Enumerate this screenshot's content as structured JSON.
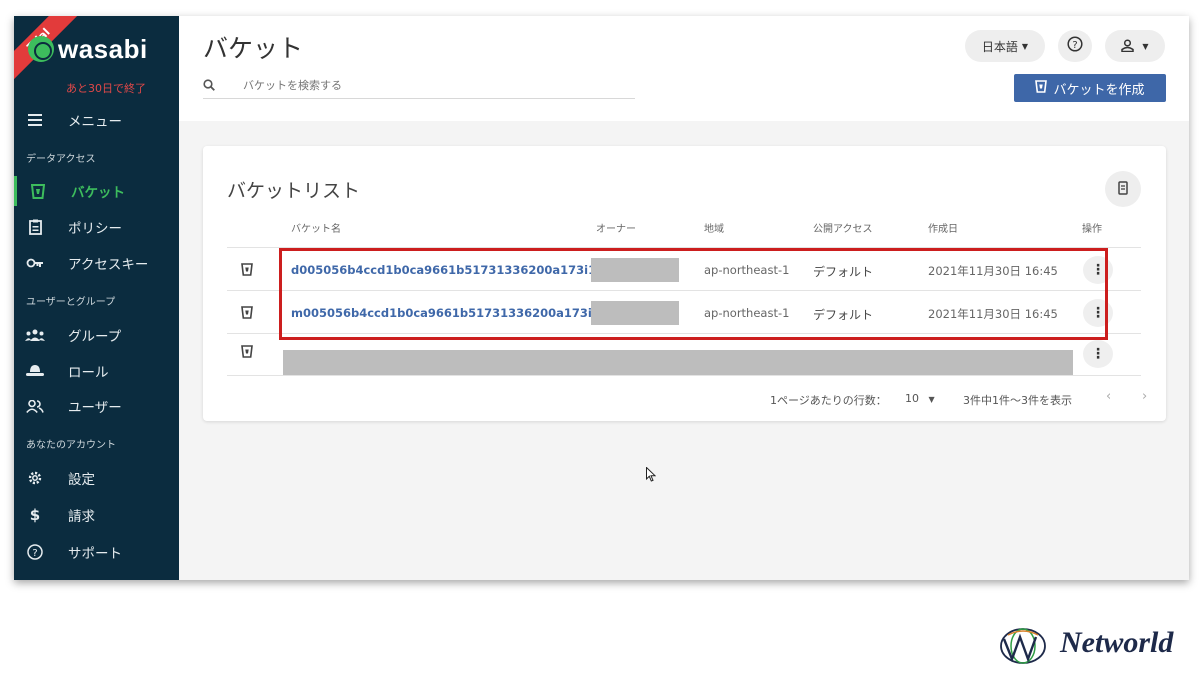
{
  "sidebar": {
    "trial_badge": "Trial",
    "brand": "wasabi",
    "trial_remaining": "あと30日で終了",
    "menu": {
      "label": "メニュー",
      "icon": "hamburger-icon"
    },
    "sections": {
      "data_access": "データアクセス",
      "users_groups": "ユーザーとグループ",
      "your_account": "あなたのアカウント"
    },
    "items": [
      {
        "label": "バケット",
        "icon": "bucket-icon",
        "active": true
      },
      {
        "label": "ポリシー",
        "icon": "clipboard-icon",
        "active": false
      },
      {
        "label": "アクセスキー",
        "icon": "key-icon",
        "active": false
      },
      {
        "label": "グループ",
        "icon": "group-icon",
        "active": false
      },
      {
        "label": "ロール",
        "icon": "hat-icon",
        "active": false
      },
      {
        "label": "ユーザー",
        "icon": "users-icon",
        "active": false
      },
      {
        "label": "設定",
        "icon": "gear-icon",
        "active": false
      },
      {
        "label": "請求",
        "icon": "dollar-icon",
        "active": false
      },
      {
        "label": "サポート",
        "icon": "help-icon",
        "active": false
      }
    ]
  },
  "header": {
    "title": "バケット",
    "search_placeholder": "バケットを検索する",
    "language": "日本語",
    "create_button": "バケットを作成"
  },
  "bucket_list": {
    "title": "バケットリスト",
    "columns": {
      "name": "バケット名",
      "owner": "オーナー",
      "region": "地域",
      "public_access": "公開アクセス",
      "created": "作成日",
      "actions": "操作"
    },
    "rows": [
      {
        "name": "d005056b4ccd1b0ca9661b51731336200a173i1",
        "region": "ap-northeast-1",
        "access": "デフォルト",
        "created": "2021年11月30日 16:45"
      },
      {
        "name": "m005056b4ccd1b0ca9661b51731336200a173i1",
        "region": "ap-northeast-1",
        "access": "デフォルト",
        "created": "2021年11月30日 16:45"
      }
    ],
    "pagination": {
      "rows_per_page_label": "1ページあたりの行数：",
      "rows_per_page": "10",
      "range_label": "3件中1件〜3件を表示"
    }
  },
  "watermark": "Networld",
  "colors": {
    "sidebar_bg": "#0b2c3f",
    "accent_green": "#3dbd5d",
    "primary_button": "#3e67a8",
    "link_blue": "#3f68a9",
    "highlight_red": "#cc1e1e"
  }
}
